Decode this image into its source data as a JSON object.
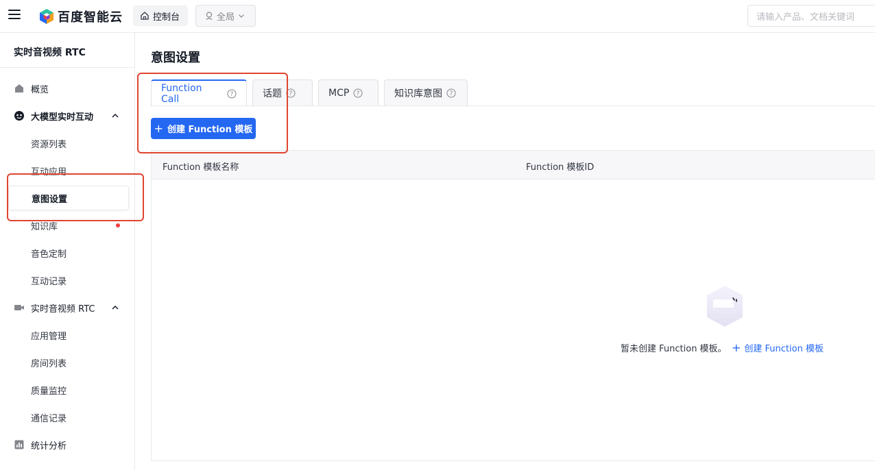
{
  "topbar": {
    "brand": "百度智能云",
    "console_label": "控制台",
    "region_label": "全局",
    "search_placeholder": "请输入产品、文档关键词"
  },
  "sidebar": {
    "title": "实时音视频 RTC",
    "items": [
      {
        "label": "概览",
        "icon": "home-icon"
      },
      {
        "label": "大模型实时互动",
        "icon": "ai-bot-icon"
      },
      {
        "label": "资源列表"
      },
      {
        "label": "互动应用"
      },
      {
        "label": "意图设置"
      },
      {
        "label": "知识库"
      },
      {
        "label": "音色定制"
      },
      {
        "label": "互动记录"
      },
      {
        "label": "实时音视频 RTC",
        "icon": "video-camera-icon"
      },
      {
        "label": "应用管理"
      },
      {
        "label": "房间列表"
      },
      {
        "label": "质量监控"
      },
      {
        "label": "通信记录"
      },
      {
        "label": "统计分析",
        "icon": "bar-chart-icon"
      }
    ]
  },
  "main": {
    "page_title": "意图设置",
    "tabs": [
      {
        "label": "Function Call"
      },
      {
        "label": "话题"
      },
      {
        "label": "MCP"
      },
      {
        "label": "知识库意图"
      }
    ],
    "create_button": "创建 Function 模板",
    "table": {
      "columns": [
        "Function 模板名称",
        "Function 模板ID"
      ],
      "empty_text": "暂未创建 Function 模板。",
      "empty_link": "创建 Function 模板"
    }
  },
  "colors": {
    "accent": "#2468f2",
    "annotation": "#e0442f",
    "badge": "#f33e3e"
  }
}
